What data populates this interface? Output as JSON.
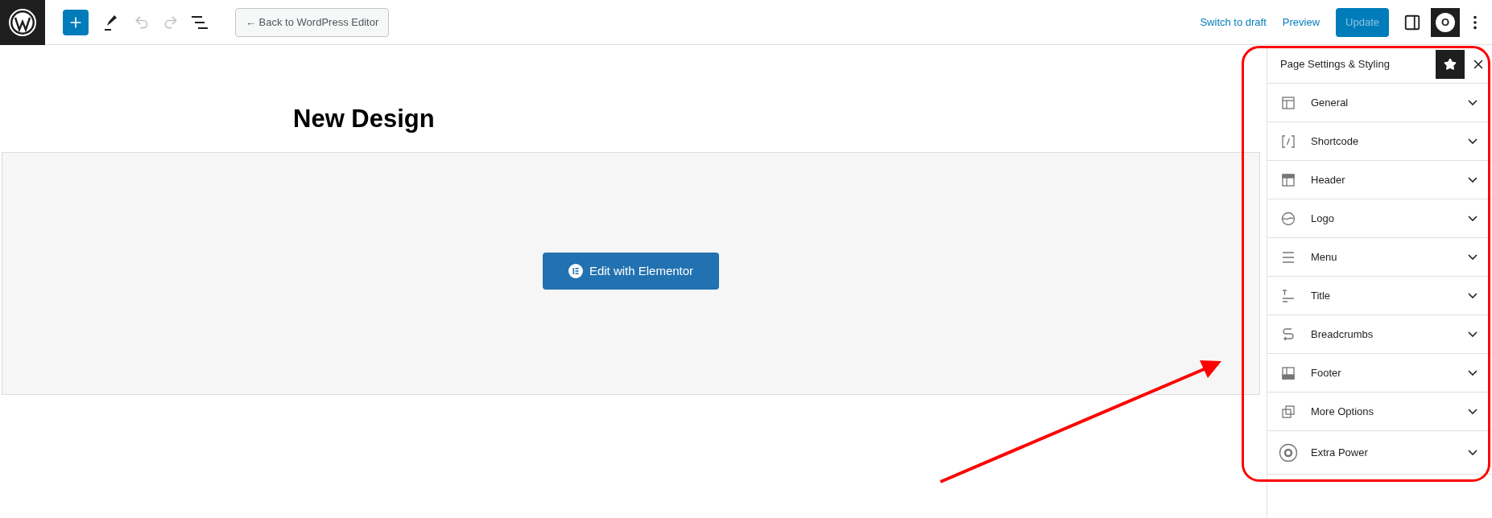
{
  "toolbar": {
    "add_button": {
      "selected": true
    },
    "undo": {
      "disabled": true
    },
    "redo": {
      "disabled": true
    },
    "back_button": "← Back to WordPress Editor",
    "links": [
      "Switch to draft",
      "Preview"
    ],
    "update_button": {
      "label": "Update",
      "disabled": true
    },
    "plugin_button": {
      "label": "O"
    }
  },
  "editor": {
    "title": "New Design",
    "edit_button": "Edit with Elementor"
  },
  "sidebar": {
    "title": "Page Settings & Styling",
    "items": [
      {
        "label": "General",
        "expanded": false
      },
      {
        "label": "Shortcode",
        "expanded": false
      },
      {
        "label": "Header",
        "expanded": false
      },
      {
        "label": "Logo",
        "expanded": false
      },
      {
        "label": "Menu",
        "expanded": false
      },
      {
        "label": "Title",
        "expanded": false
      },
      {
        "label": "Breadcrumbs",
        "expanded": false
      },
      {
        "label": "Footer",
        "expanded": false
      },
      {
        "label": "More Options",
        "expanded": false
      },
      {
        "label": "Extra Power",
        "expanded": false
      }
    ]
  },
  "highlight": {
    "color": "#ff0000"
  },
  "arrow": {
    "color": "#ff0000"
  }
}
